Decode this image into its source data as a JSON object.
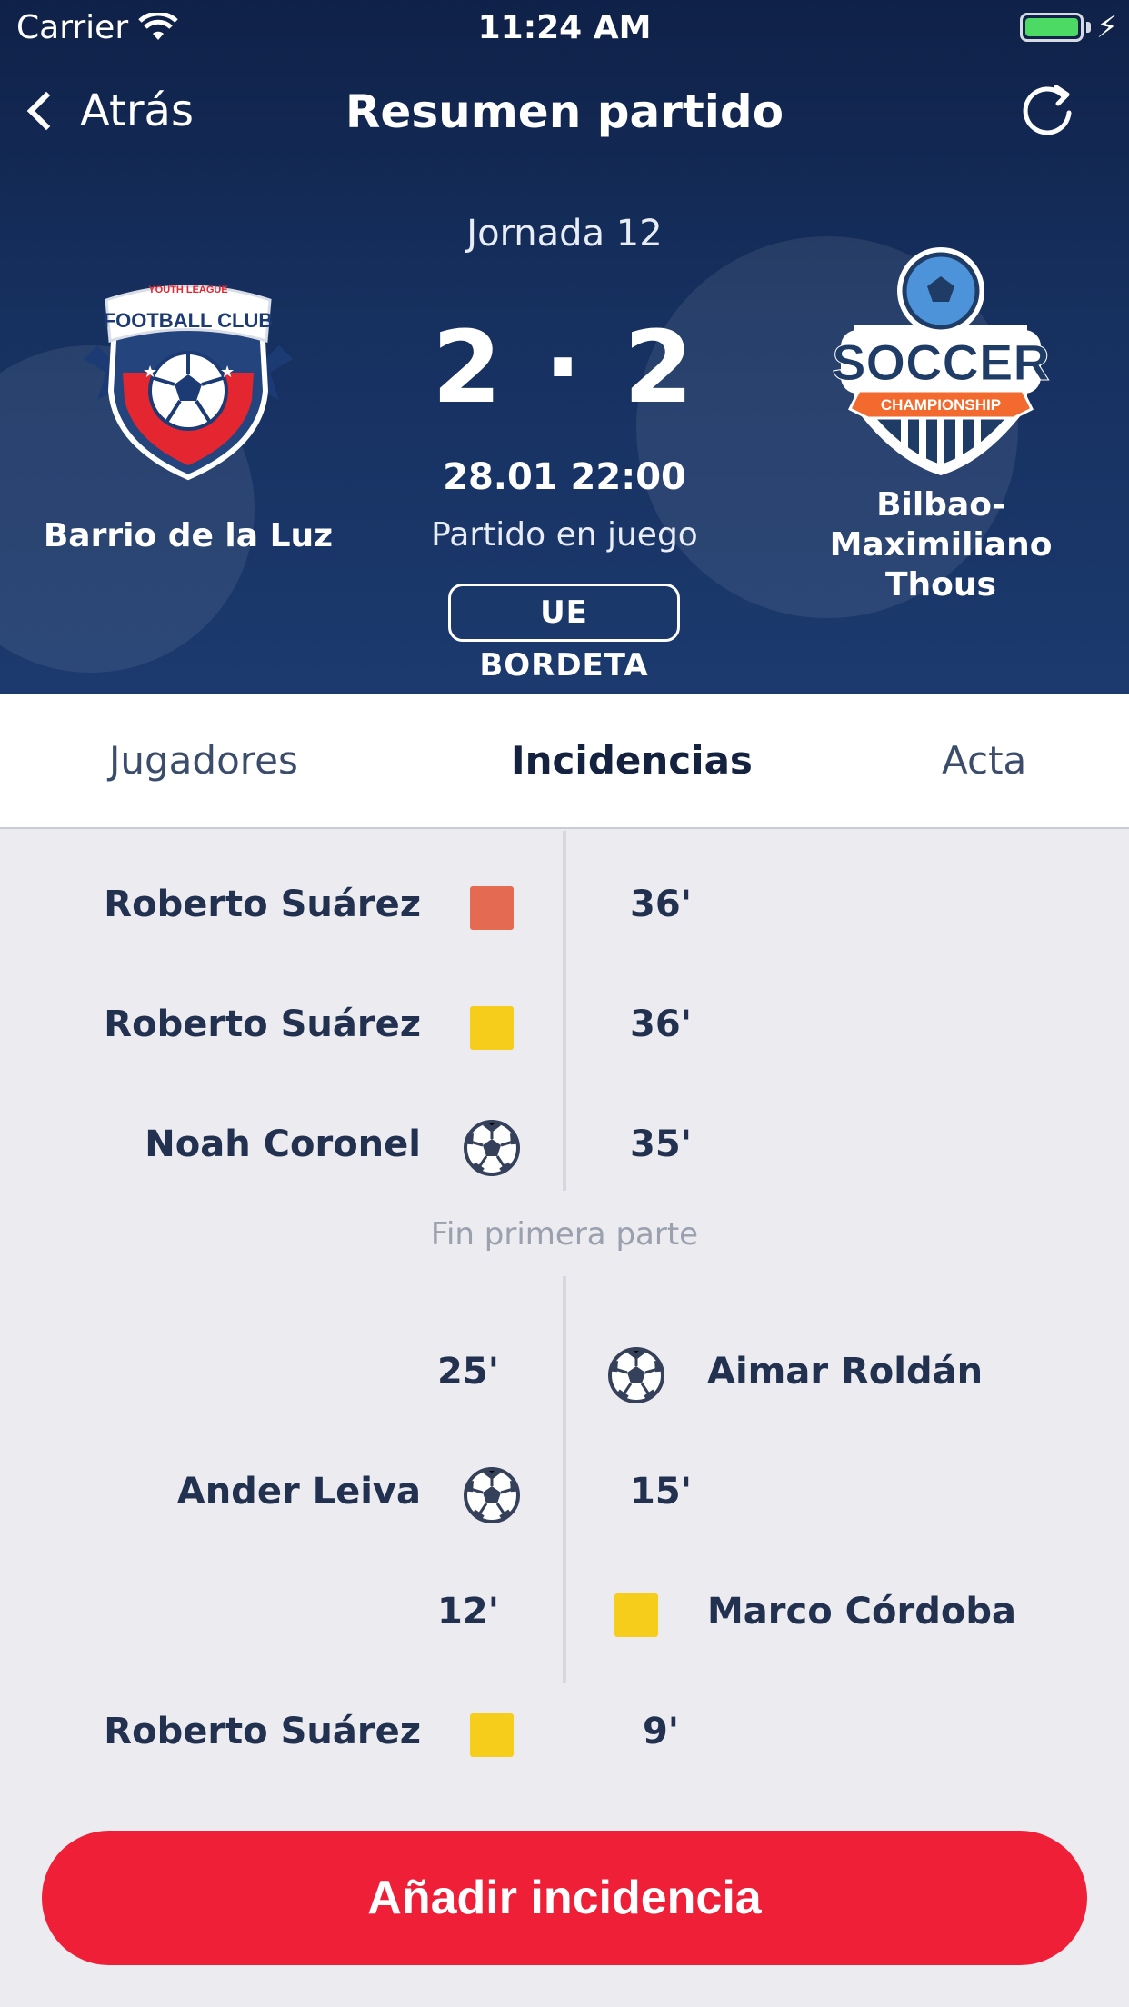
{
  "status_bar": {
    "carrier": "Carrier",
    "time": "11:24 AM"
  },
  "nav": {
    "back_label": "Atrás",
    "title": "Resumen partido"
  },
  "match": {
    "jornada": "Jornada 12",
    "score": "2 · 2",
    "datetime": "28.01 22:00",
    "status": "Partido en juego",
    "venue": "UE BORDETA",
    "home": {
      "name": "Barrio de la Luz",
      "logo_top": "YOUTH LEAGUE",
      "logo_text": "FOOTBALL CLUB"
    },
    "away": {
      "name": "Bilbao-Maximiliano Thous",
      "logo_text": "SOCCER",
      "logo_ribbon": "CHAMPIONSHIP"
    }
  },
  "tabs": [
    {
      "label": "Jugadores",
      "active": false
    },
    {
      "label": "Incidencias",
      "active": true
    },
    {
      "label": "Acta",
      "active": false
    }
  ],
  "incidents_second_half": [
    {
      "side": "home",
      "player": "Roberto Suárez",
      "type": "red-card",
      "minute": "36'"
    },
    {
      "side": "home",
      "player": "Roberto Suárez",
      "type": "yellow-card",
      "minute": "36'"
    },
    {
      "side": "home",
      "player": "Noah Coronel",
      "type": "goal",
      "minute": "35'"
    }
  ],
  "halftime_label": "Fin primera parte",
  "incidents_first_half": [
    {
      "side": "away",
      "player": "Aimar Roldán",
      "type": "goal",
      "minute": "25'"
    },
    {
      "side": "home",
      "player": "Ander Leiva",
      "type": "goal",
      "minute": "15'"
    },
    {
      "side": "away",
      "player": "Marco Córdoba",
      "type": "yellow-card",
      "minute": "12'"
    },
    {
      "side": "home",
      "player": "Roberto Suárez",
      "type": "yellow-card",
      "minute": "9'"
    }
  ],
  "add_button_label": "Añadir incidencia",
  "colors": {
    "header": "#16305f",
    "accent": "#ef1f37",
    "red_card": "#e46a51",
    "yellow_card": "#f7cd1b"
  }
}
